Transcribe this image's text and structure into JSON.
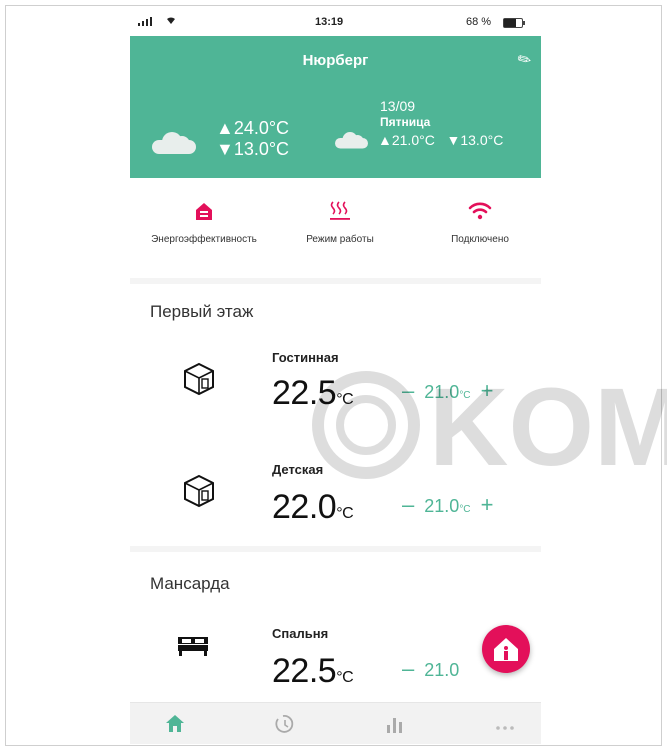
{
  "status_bar": {
    "time": "13:19",
    "battery": "68 %"
  },
  "header": {
    "city": "Нюрберг",
    "current": {
      "high": "▲24.0°C",
      "low": "▼13.0°C",
      "icon": "cloud-icon"
    },
    "forecast": {
      "date": "13/09",
      "day": "Пятница",
      "high": "▲21.0°C",
      "low": "▼13.0°C",
      "icon": "cloud-icon"
    },
    "bg_color": "#4fb596"
  },
  "stats": [
    {
      "label": "Энергоэффективность",
      "icon": "house-icon"
    },
    {
      "label": "Режим работы",
      "icon": "heat-waves-icon"
    },
    {
      "label": "Подключено",
      "icon": "wifi-icon"
    }
  ],
  "zones": [
    {
      "title": "Первый этаж",
      "rooms": [
        {
          "name": "Гостинная",
          "temp": "22.5",
          "temp_unit": "°C",
          "setpoint": "21.0",
          "setpoint_unit": "°C",
          "minus": "–",
          "plus": "+",
          "icon": "room-cube-icon"
        },
        {
          "name": "Детская",
          "temp": "22.0",
          "temp_unit": "°C",
          "setpoint": "21.0",
          "setpoint_unit": "°C",
          "minus": "–",
          "plus": "+",
          "icon": "room-cube-icon"
        }
      ]
    },
    {
      "title": "Мансарда",
      "rooms": [
        {
          "name": "Спальня",
          "temp": "22.5",
          "temp_unit": "°C",
          "setpoint": "21.0",
          "minus": "–",
          "icon": "bed-icon"
        }
      ]
    }
  ],
  "nav": [
    {
      "name": "home",
      "icon": "home-icon",
      "active": true
    },
    {
      "name": "schedule",
      "icon": "clock-icon",
      "active": false
    },
    {
      "name": "stats",
      "icon": "bar-chart-icon",
      "active": false
    },
    {
      "name": "more",
      "icon": "more-icon",
      "active": false
    }
  ],
  "watermark": {
    "text": "KOM"
  },
  "colors": {
    "accent": "#4fb596",
    "alert": "#e3105a"
  }
}
